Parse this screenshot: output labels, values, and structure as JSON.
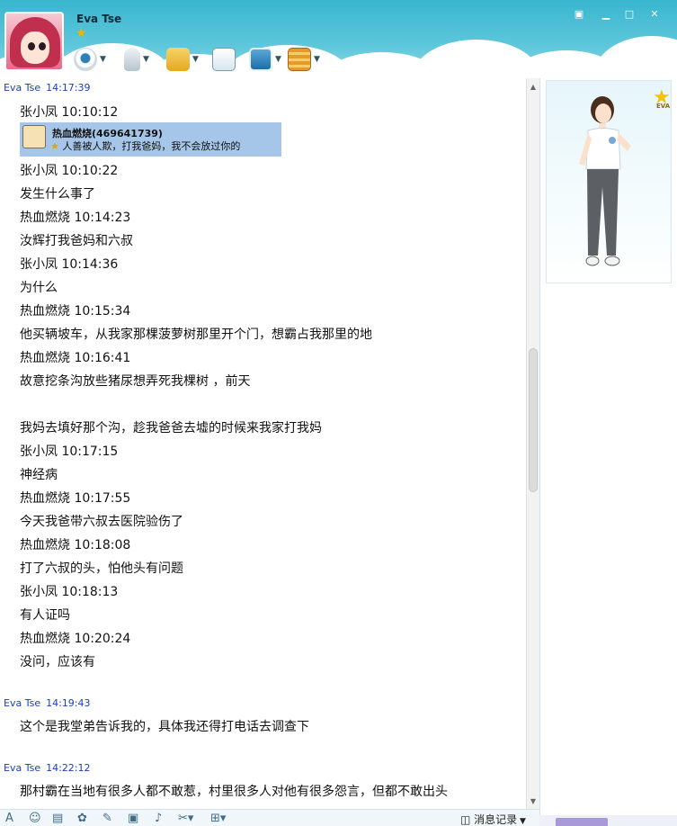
{
  "header": {
    "user_name": "Eva Tse",
    "user_level_icon": "star-icon"
  },
  "toolbar": {
    "buttons": [
      {
        "name": "webcam-icon",
        "has_menu": true
      },
      {
        "name": "microphone-icon",
        "has_menu": true
      },
      {
        "name": "send-file-icon",
        "has_menu": true
      },
      {
        "name": "create-discussion-icon",
        "has_menu": false
      },
      {
        "name": "remote-assistance-icon",
        "has_menu": true
      },
      {
        "name": "apps-icon",
        "has_menu": true
      }
    ]
  },
  "window_buttons": [
    "menu-icon",
    "minimize-icon",
    "maximize-icon",
    "close-icon"
  ],
  "colors": {
    "header_sky": "#39b6cf",
    "sender_name": "#1a40b8",
    "card_bg": "#a5c6e8"
  },
  "chat": {
    "message1": {
      "sender": "Eva Tse",
      "time": "14:17:39"
    },
    "card": {
      "name": "热血燃烧(469641739)",
      "signature": "人善被人欺，打我爸妈，我不会放过你的"
    },
    "lines": [
      "张小凤 10:10:12",
      "张小凤 10:10:22",
      "发生什么事了",
      "热血燃烧 10:14:23",
      "汝辉打我爸妈和六叔",
      "张小凤 10:14:36",
      "为什么",
      "热血燃烧 10:15:34",
      "他买辆坡车，从我家那棵菠萝树那里开个门，想霸占我那里的地",
      "热血燃烧 10:16:41",
      "故意挖条沟放些猪尿想弄死我棵树 ，前天",
      "我妈去填好那个沟，趁我爸爸去墟的时候来我家打我妈",
      "张小凤 10:17:15",
      "神经病",
      "热血燃烧 10:17:55",
      "今天我爸带六叔去医院验伤了",
      "热血燃烧 10:18:08",
      "打了六叔的头，怕他头有问题",
      "张小凤 10:18:13",
      "有人证吗",
      "热血燃烧 10:20:24",
      "没问，应该有"
    ],
    "message2": {
      "sender": "Eva Tse",
      "time": "14:19:43",
      "text": "这个是我堂弟告诉我的，具体我还得打电话去调查下"
    },
    "message3": {
      "sender": "Eva Tse",
      "time": "14:22:12",
      "text": "那村霸在当地有很多人都不敢惹，村里很多人对他有很多怨言，但都不敢出头"
    }
  },
  "bottom_toolbar": {
    "icons": [
      "font-icon",
      "emoticon-icon",
      "print-icon",
      "magic-icon",
      "edit-icon",
      "image-icon",
      "music-icon",
      "screenshot-icon",
      "more-icon"
    ],
    "history_label": "消息记录"
  },
  "right_panel": {
    "rank_label": "EVA"
  }
}
